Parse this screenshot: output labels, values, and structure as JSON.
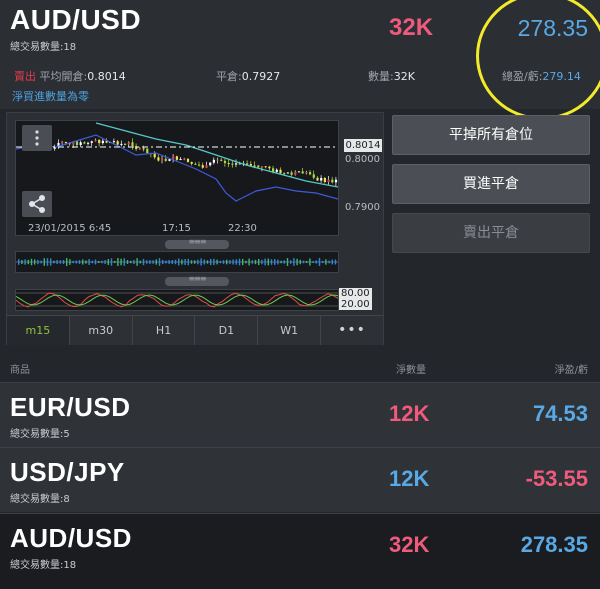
{
  "header": {
    "pair": "AUD/USD",
    "total_trades": "總交易數量:18",
    "net_quantity": "32K",
    "pnl": "278.35",
    "sell_label": "賣出",
    "avg_open_label": "平均開倉:",
    "avg_open_value": "0.8014",
    "close_label": "平倉:",
    "close_value": "0.7927",
    "qty_label": "數量:",
    "qty_value": "32K",
    "total_pnl_label": "總盈/虧:",
    "total_pnl_value": "279.14",
    "net_buy_zero": "淨買進數量為零"
  },
  "chart": {
    "price_line": "0.8014",
    "y_ticks": [
      "0.8000",
      "0.7900"
    ],
    "x_ticks": [
      "23/01/2015 6:45",
      "17:15",
      "22:30"
    ],
    "osc_ticks": [
      "80.00",
      "20.00"
    ],
    "timeframes": [
      "m15",
      "m30",
      "H1",
      "D1",
      "W1"
    ],
    "active_timeframe": "m15",
    "more_label": "•••"
  },
  "actions": {
    "close_all": "平掉所有倉位",
    "buy_close": "買進平倉",
    "sell_close": "賣出平倉"
  },
  "list": {
    "col_product": "商品",
    "col_net_qty": "淨數量",
    "col_pnl": "淨盈/虧",
    "rows": [
      {
        "pair": "EUR/USD",
        "count": "總交易數量:5",
        "qty": "12K",
        "qty_color": "#ef5a7d",
        "pnl": "74.53",
        "pnl_color": "#58a9e6"
      },
      {
        "pair": "USD/JPY",
        "count": "總交易數量:8",
        "qty": "12K",
        "qty_color": "#58a9e6",
        "pnl": "-53.55",
        "pnl_color": "#ef5a7d"
      },
      {
        "pair": "AUD/USD",
        "count": "總交易數量:18",
        "qty": "32K",
        "qty_color": "#ef5a7d",
        "pnl": "278.35",
        "pnl_color": "#58a9e6"
      }
    ]
  },
  "colors": {
    "positive": "#58a9e6",
    "negative": "#ef5a7d",
    "highlight": "#f2eb2b",
    "active_tab": "#8fc33a"
  }
}
